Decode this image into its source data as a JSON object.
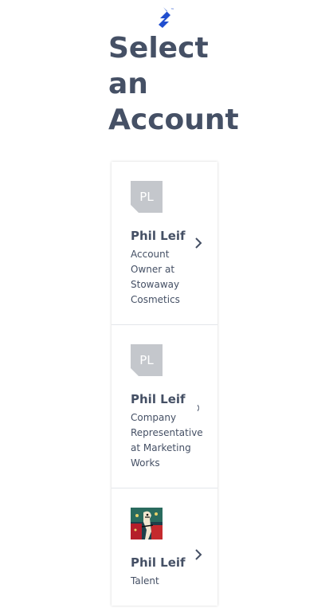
{
  "brand": {
    "logo_icon": "toptal-logo-icon",
    "trademark": "™",
    "color": "#204ecf"
  },
  "page": {
    "title": "Select an Account"
  },
  "accounts": [
    {
      "initials": "PL",
      "name": "Phil Leif",
      "role": "Account Owner at Stowaway Cosmetics",
      "avatar_icon": "initials-avatar"
    },
    {
      "initials": "PL",
      "name": "Phil Leif",
      "role": "Company Representative at Marketing Works",
      "avatar_icon": "initials-avatar"
    },
    {
      "initials": "",
      "name": "Phil Leif",
      "role": "Talent",
      "avatar_icon": "photo-avatar"
    }
  ],
  "colors": {
    "text": "#455065",
    "avatar_bg": "#c4c7cc",
    "border": "#e3e6ea"
  }
}
